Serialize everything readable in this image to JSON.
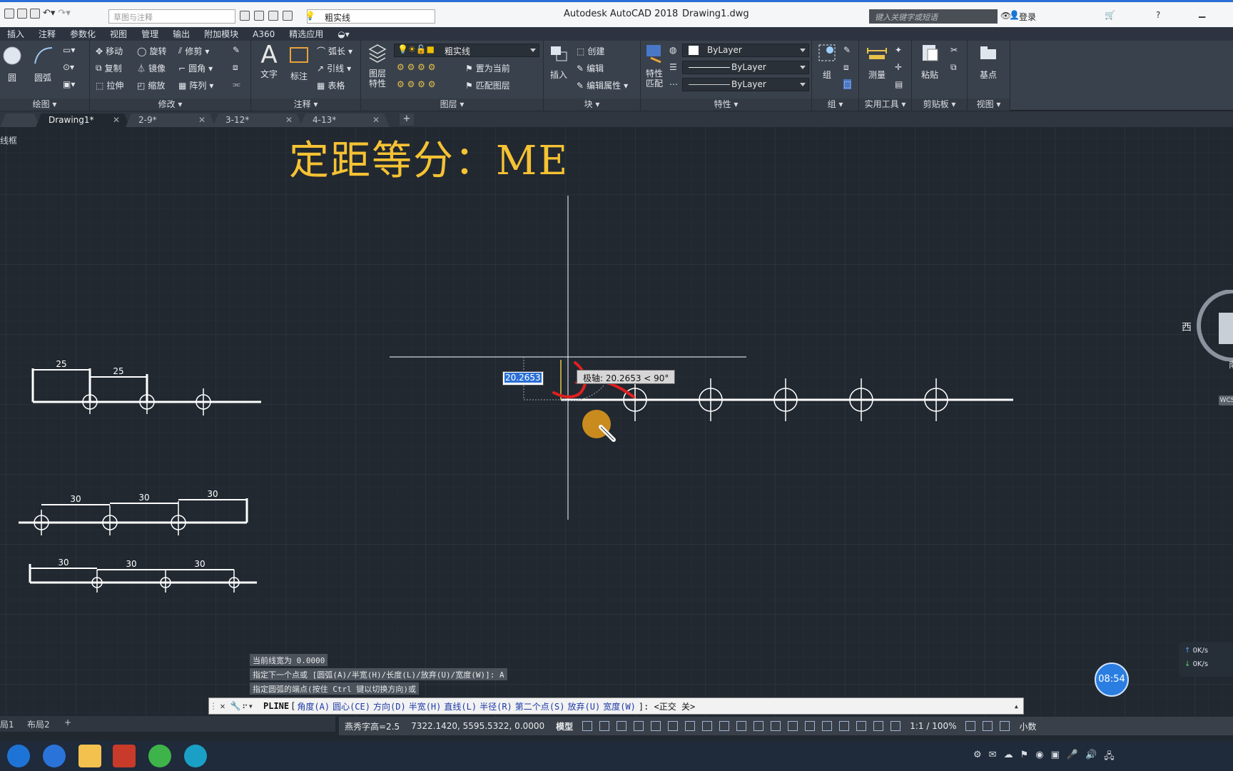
{
  "window": {
    "app_title": "Autodesk AutoCAD 2018",
    "file_title": "Drawing1.dwg",
    "workspace_placeholder": "草图与注释",
    "layer_name": "粗实线",
    "search_placeholder": "键入关键字或短语",
    "login_label": "登录"
  },
  "menu": [
    "插入",
    "注释",
    "参数化",
    "视图",
    "管理",
    "输出",
    "附加模块",
    "A360",
    "精选应用"
  ],
  "ribbon": {
    "draw": {
      "title": "绘图",
      "circle": "圆",
      "arc": "圆弧"
    },
    "modify": {
      "title": "修改",
      "move": "移动",
      "rotate": "旋转",
      "trim": "修剪",
      "copy": "复制",
      "mirror": "镜像",
      "fillet": "圆角",
      "stretch": "拉伸",
      "scale": "缩放",
      "array": "阵列"
    },
    "annotation": {
      "title": "注释",
      "text": "文字",
      "dimension": "标注",
      "leader": "引线",
      "table": "表格",
      "arc_length": "弧长"
    },
    "layers": {
      "title": "图层",
      "layer_props": "图层\n特性",
      "layer_name": "粗实线",
      "set_current": "置为当前",
      "match_layer": "匹配图层"
    },
    "block": {
      "title": "块",
      "insert": "插入",
      "create": "创建",
      "edit": "编辑",
      "edit_attr": "编辑属性"
    },
    "properties": {
      "title": "特性",
      "match": "特性\n匹配",
      "color": "ByLayer",
      "linetype": "ByLayer",
      "lineweight": "ByLayer"
    },
    "groups": {
      "title": "组",
      "group": "组"
    },
    "utilities": {
      "title": "实用工具",
      "measure": "测量"
    },
    "clipboard": {
      "title": "剪贴板",
      "paste": "粘贴"
    },
    "view": {
      "title": "视图",
      "base": "基点"
    }
  },
  "tabs": [
    {
      "label": "Drawing1*",
      "active": true
    },
    {
      "label": "2-9*",
      "active": false
    },
    {
      "label": "3-12*",
      "active": false
    },
    {
      "label": "4-13*",
      "active": false
    }
  ],
  "canvas": {
    "view_label": "线框",
    "heading": "定距等分：ME",
    "compass_west": "西",
    "compass_south": "南",
    "wcs": "WCS",
    "dim_input": "20.2653",
    "dim_tooltip": "极轴: 20.2653 < 90°",
    "drawing_dims": {
      "top": [
        "25",
        "25"
      ],
      "middle": [
        "30",
        "30",
        "30"
      ],
      "bottom": [
        "30",
        "30",
        "30"
      ]
    }
  },
  "command": {
    "history": [
      "当前线宽为 0.0000",
      "指定下一个点或 [圆弧(A)/半宽(H)/长度(L)/放弃(U)/宽度(W)]: A",
      "指定圆弧的端点(按住 Ctrl 键以切换方向)或"
    ],
    "prompt_cmd": "PLINE",
    "options": [
      {
        "label": "角度",
        "key": "(A)"
      },
      {
        "label": "圆心",
        "key": "(CE)"
      },
      {
        "label": "方向",
        "key": "(D)"
      },
      {
        "label": "半宽",
        "key": "(H)"
      },
      {
        "label": "直线",
        "key": "(L)"
      },
      {
        "label": "半径",
        "key": "(R)"
      },
      {
        "label": "第二个点",
        "key": "(S)"
      },
      {
        "label": "放弃",
        "key": "(U)"
      },
      {
        "label": "宽度",
        "key": "(W)"
      }
    ],
    "prompt_tail": "]:  <正交 关>"
  },
  "layout_tabs": [
    "局1",
    "布局2"
  ],
  "status": {
    "font_info": "燕秀字高=2.5",
    "coords": "7322.1420, 5595.5322, 0.0000",
    "model": "模型",
    "scale": "1:1 / 100%",
    "units": "小数"
  },
  "overlays": {
    "timer": "08:54",
    "net_up": "0K/s",
    "net_down": "0K/s"
  },
  "colors": {
    "canvas_bg": "#212830",
    "heading": "#f5c233",
    "annotation_red": "#e01f1f",
    "cursor_marker": "#c98a1e"
  }
}
